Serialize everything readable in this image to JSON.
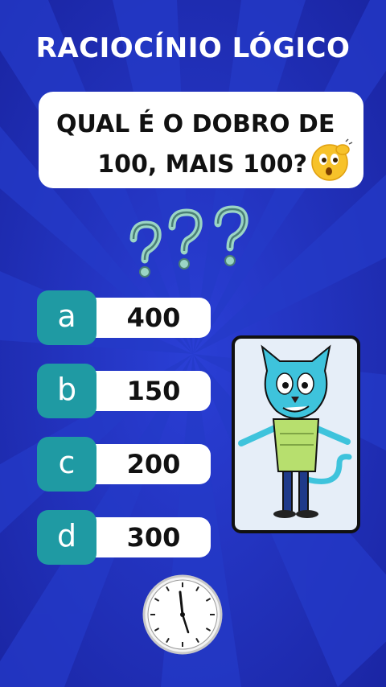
{
  "header": {
    "title": "RACIOCÍNIO LÓGICO"
  },
  "question": {
    "line1": "QUAL É O DOBRO DE",
    "line2": "100, MAIS 100?",
    "emoji_icon": "thinking-face-icon"
  },
  "decoration": {
    "question_marks_icon": "question-marks-icon"
  },
  "answers": [
    {
      "letter": "a",
      "value": "400"
    },
    {
      "letter": "b",
      "value": "150"
    },
    {
      "letter": "c",
      "value": "200"
    },
    {
      "letter": "d",
      "value": "300"
    }
  ],
  "character": {
    "icon": "cartoon-cat-character-icon"
  },
  "timer": {
    "icon": "clock-icon"
  },
  "colors": {
    "background": "#1f2fb8",
    "accent_teal": "#1f9aa3",
    "card_white": "#ffffff"
  }
}
